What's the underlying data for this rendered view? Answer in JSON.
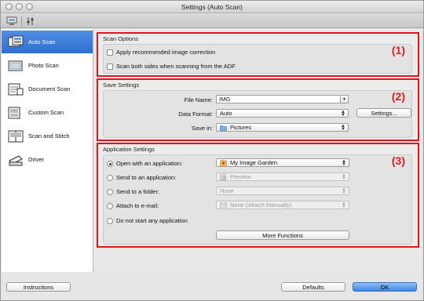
{
  "window": {
    "title": "Settings (Auto Scan)"
  },
  "sidebar": {
    "items": [
      {
        "label": "Auto Scan",
        "icon": "auto-scan-icon",
        "active": true
      },
      {
        "label": "Photo Scan",
        "icon": "photo-scan-icon",
        "active": false
      },
      {
        "label": "Document Scan",
        "icon": "document-scan-icon",
        "active": false
      },
      {
        "label": "Custom Scan",
        "icon": "custom-scan-icon",
        "active": false
      },
      {
        "label": "Scan and Stitch",
        "icon": "scan-stitch-icon",
        "active": false
      },
      {
        "label": "Driver",
        "icon": "driver-icon",
        "active": false
      }
    ]
  },
  "scan_options": {
    "title": "Scan Options",
    "marker": "(1)",
    "apply_correction_label": "Apply recommended image correction",
    "apply_correction_checked": false,
    "both_sides_label": "Scan both sides when scanning from the ADF",
    "both_sides_checked": false
  },
  "save_settings": {
    "title": "Save Settings",
    "marker": "(2)",
    "file_name_label": "File Name:",
    "file_name_value": "IMG",
    "data_format_label": "Data Format:",
    "data_format_value": "Auto",
    "save_in_label": "Save in:",
    "save_in_value": "Pictures",
    "settings_button": "Settings..."
  },
  "application_settings": {
    "title": "Application Settings",
    "marker": "(3)",
    "options": [
      {
        "label": "Open with an application:",
        "selected": true,
        "value": "My Image Garden",
        "enabled": true
      },
      {
        "label": "Send to an application:",
        "selected": false,
        "value": "Preview",
        "enabled": false
      },
      {
        "label": "Send to a folder:",
        "selected": false,
        "value": "None",
        "enabled": false
      },
      {
        "label": "Attach to e-mail:",
        "selected": false,
        "value": "None (Attach Manually)",
        "enabled": false
      },
      {
        "label": "Do not start any application",
        "selected": false
      }
    ],
    "more_functions_button": "More Functions"
  },
  "footer": {
    "instructions_button": "Instructions",
    "defaults_button": "Defaults",
    "ok_button": "OK"
  },
  "colors": {
    "highlight": "#e0171e",
    "sidebar_active": "#3a7bd8",
    "ok_button": "#4a90e6"
  }
}
